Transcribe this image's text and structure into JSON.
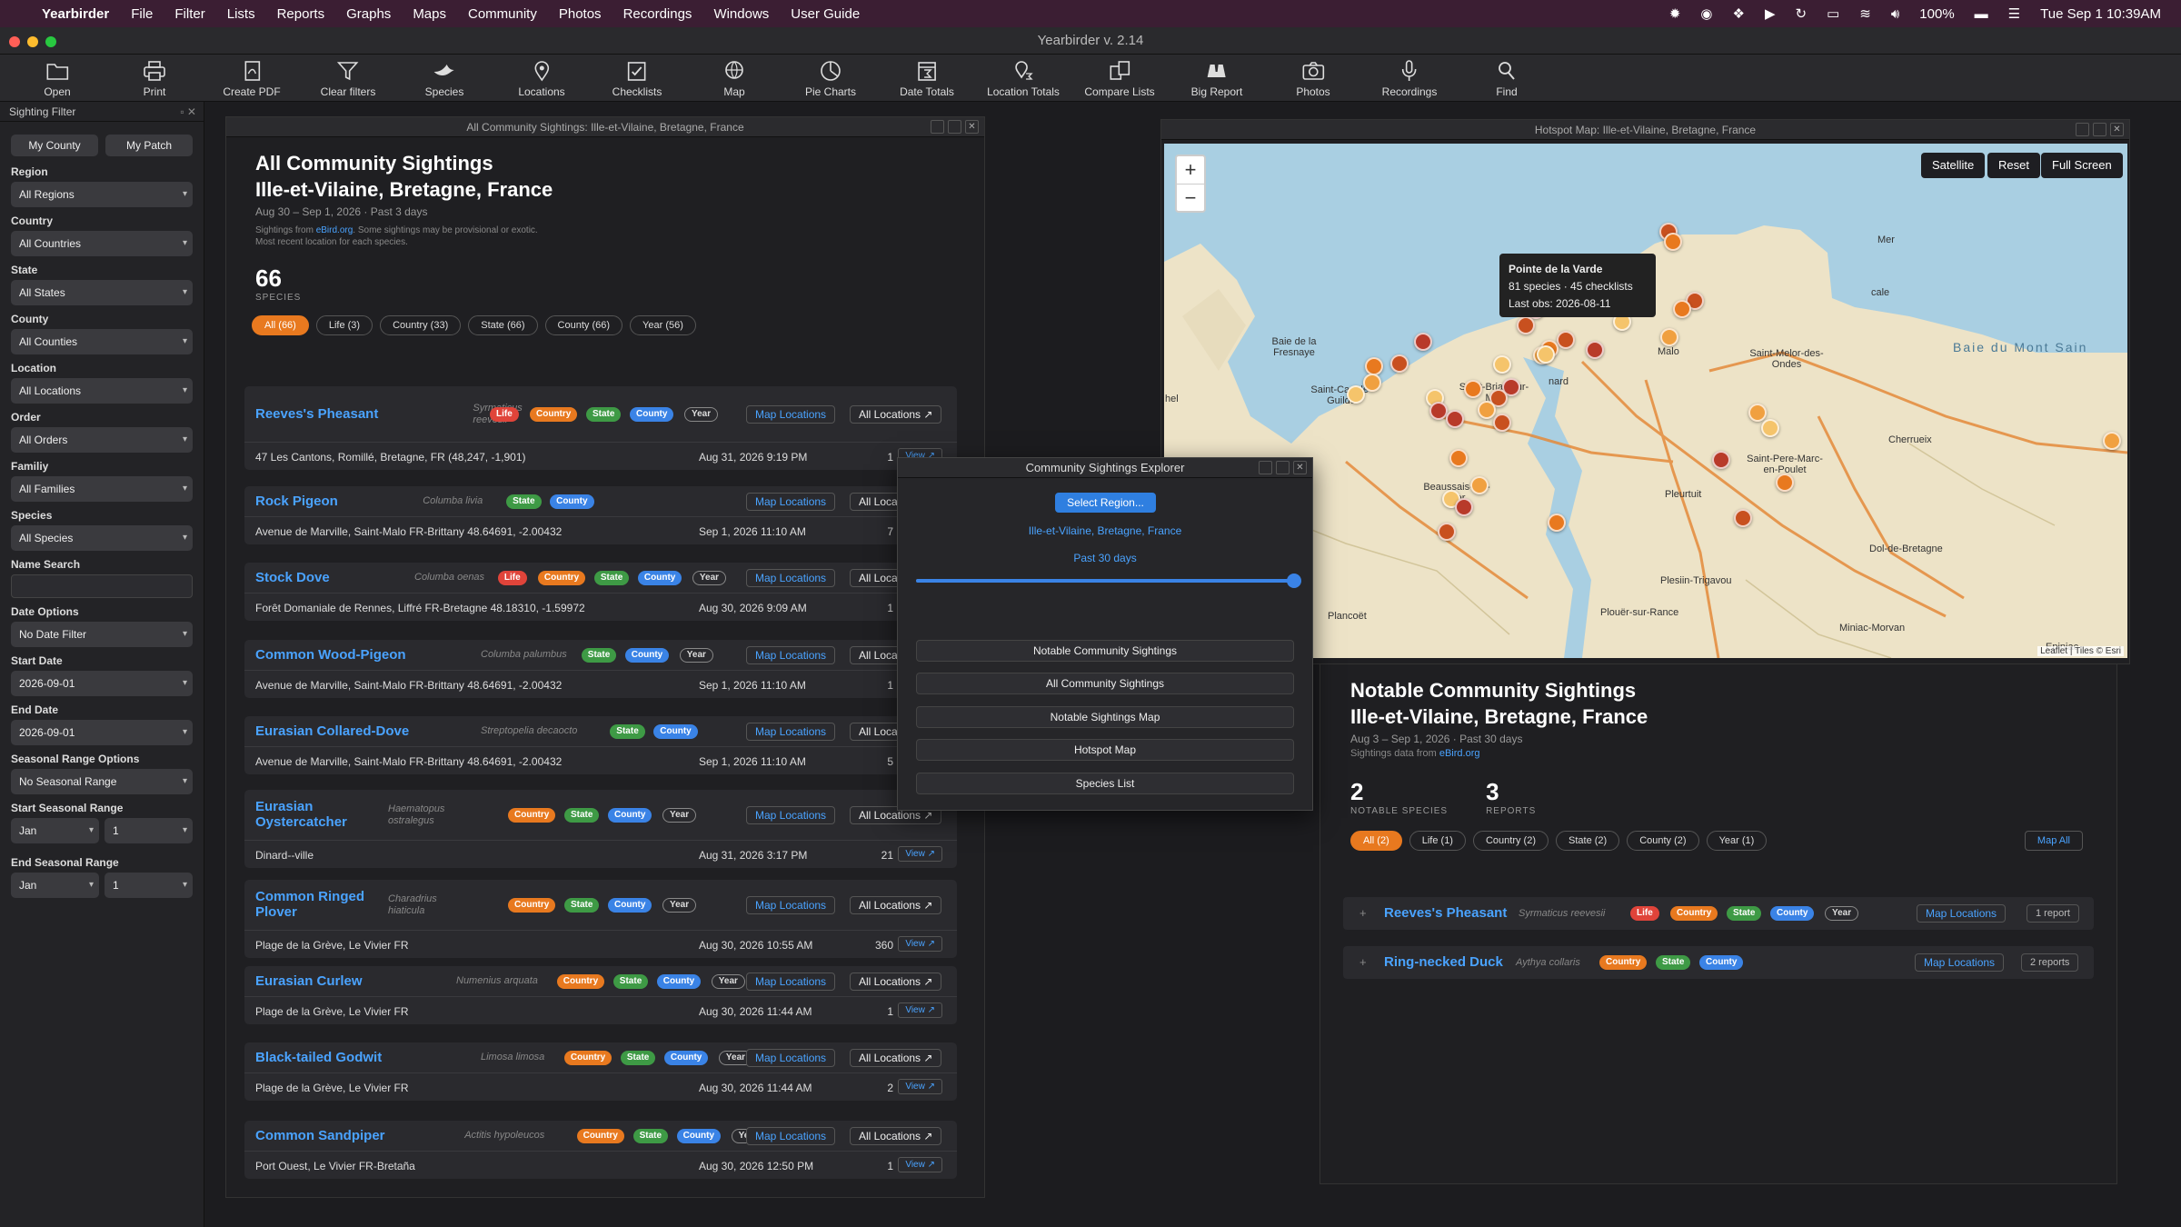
{
  "menubar": {
    "app": "Yearbirder",
    "items": [
      "File",
      "Filter",
      "Lists",
      "Reports",
      "Graphs",
      "Maps",
      "Community",
      "Photos",
      "Recordings",
      "Windows",
      "User Guide"
    ],
    "battery": "100%",
    "datetime": "Tue Sep 1  10:39AM"
  },
  "window": {
    "title": "Yearbirder v. 2.14"
  },
  "toolbar": [
    "Open",
    "Print",
    "Create PDF",
    "Clear filters",
    "Species",
    "Locations",
    "Checklists",
    "Map",
    "Pie Charts",
    "Date Totals",
    "Location Totals",
    "Compare Lists",
    "Big Report",
    "Photos",
    "Recordings",
    "Find"
  ],
  "sidebar": {
    "title": "Sighting Filter",
    "my_county": "My County",
    "my_patch": "My Patch",
    "fields": [
      {
        "label": "Region",
        "value": "All Regions"
      },
      {
        "label": "Country",
        "value": "All Countries"
      },
      {
        "label": "State",
        "value": "All States"
      },
      {
        "label": "County",
        "value": "All Counties"
      },
      {
        "label": "Location",
        "value": "All Locations"
      },
      {
        "label": "Order",
        "value": "All Orders"
      },
      {
        "label": "Familiy",
        "value": "All Families"
      },
      {
        "label": "Species",
        "value": "All Species"
      }
    ],
    "name_search": "Name Search",
    "date_options": "Date Options",
    "date_filter": "No Date Filter",
    "start_date_label": "Start Date",
    "start_date": "2026-09-01",
    "end_date_label": "End Date",
    "end_date": "2026-09-01",
    "seasonal_label": "Seasonal Range Options",
    "seasonal": "No Seasonal Range",
    "start_seasonal_label": "Start Seasonal Range",
    "end_seasonal_label": "End Seasonal Range",
    "month": "Jan",
    "day": "1"
  },
  "all_panel": {
    "window_title": "All Community Sightings: Ille-et-Vilaine, Bretagne, France",
    "title1": "All Community Sightings",
    "title2": "Ille-et-Vilaine, Bretagne, France",
    "range": "Aug 30 – Sep 1, 2026  ·  Past 3 days",
    "note_pre": "Sightings from ",
    "note_link": "eBird.org",
    "note_post": ". Some sightings may be provisional or exotic.",
    "note2": "Most recent location for each species.",
    "count": "66",
    "count_label": "SPECIES",
    "filters": [
      "All (66)",
      "Life (3)",
      "Country (33)",
      "State (66)",
      "County (66)",
      "Year (56)"
    ],
    "map_locations": "Map Locations",
    "all_locations": "All Locations ↗",
    "all_loca": "All Loca",
    "view": "View ↗",
    "rows": [
      {
        "name": "Reeves's Pheasant",
        "name2": "",
        "sci": "Syrmaticus",
        "sci2": "reevesii",
        "badges": [
          "Life",
          "Country",
          "State",
          "County",
          "Year"
        ],
        "loc": "47 Les Cantons, Romillé, Bretagne, FR (48,247, -1,901)",
        "date": "Aug 31, 2026 9:19 PM",
        "count": "1"
      },
      {
        "name": "Rock Pigeon",
        "sci": "Columba livia",
        "badges": [
          "State",
          "County"
        ],
        "loc": "Avenue de Marville, Saint-Malo FR-Brittany 48.64691, -2.00432",
        "date": "Sep 1, 2026 11:10 AM",
        "count": "7"
      },
      {
        "name": "Stock Dove",
        "sci": "Columba oenas",
        "badges": [
          "Life",
          "Country",
          "State",
          "County",
          "Year"
        ],
        "loc": "Forêt Domaniale de Rennes, Liffré FR-Bretagne 48.18310, -1.59972",
        "date": "Aug 30, 2026 9:09 AM",
        "count": "1"
      },
      {
        "name": "Common Wood-Pigeon",
        "sci": "Columba palumbus",
        "badges": [
          "State",
          "County",
          "Year"
        ],
        "loc": "Avenue de Marville, Saint-Malo FR-Brittany 48.64691, -2.00432",
        "date": "Sep 1, 2026 11:10 AM",
        "count": "1"
      },
      {
        "name": "Eurasian Collared-Dove",
        "sci": "Streptopelia decaocto",
        "badges": [
          "State",
          "County"
        ],
        "loc": "Avenue de Marville, Saint-Malo FR-Brittany 48.64691, -2.00432",
        "date": "Sep 1, 2026 11:10 AM",
        "count": "5"
      },
      {
        "name": "Eurasian",
        "name2": "Oystercatcher",
        "sci": "Haematopus",
        "sci2": "ostralegus",
        "badges": [
          "Country",
          "State",
          "County",
          "Year"
        ],
        "loc": "Dinard--ville",
        "date": "Aug 31, 2026 3:17 PM",
        "count": "21"
      },
      {
        "name": "Common Ringed",
        "name2": "Plover",
        "sci": "Charadrius",
        "sci2": "hiaticula",
        "badges": [
          "Country",
          "State",
          "County",
          "Year"
        ],
        "loc": "Plage de la Grève, Le Vivier FR",
        "date": "Aug 30, 2026 10:55 AM",
        "count": "360"
      },
      {
        "name": "Eurasian Curlew",
        "sci": "Numenius arquata",
        "badges": [
          "Country",
          "State",
          "County",
          "Year"
        ],
        "loc": "Plage de la Grève, Le Vivier FR",
        "date": "Aug 30, 2026 11:44 AM",
        "count": "1"
      },
      {
        "name": "Black-tailed Godwit",
        "sci": "Limosa limosa",
        "badges": [
          "Country",
          "State",
          "County",
          "Year"
        ],
        "loc": "Plage de la Grève, Le Vivier FR",
        "date": "Aug 30, 2026 11:44 AM",
        "count": "2"
      },
      {
        "name": "Common Sandpiper",
        "sci": "Actitis hypoleucos",
        "badges": [
          "Country",
          "State",
          "County",
          "Year"
        ],
        "loc": "Port Ouest, Le Vivier FR-Bretaña",
        "date": "Aug 30, 2026 12:50 PM",
        "count": "1"
      }
    ]
  },
  "explorer": {
    "title": "Community Sightings Explorer",
    "select_region": "Select Region...",
    "region": "Ille-et-Vilaine, Bretagne, France",
    "range": "Past 30 days",
    "slider": 1.0,
    "buttons": [
      "Notable Community Sightings",
      "All Community Sightings",
      "Notable Sightings Map",
      "Hotspot Map",
      "Species List"
    ]
  },
  "map_panel": {
    "window_title": "Hotspot Map: Ille-et-Vilaine, Bretagne, France",
    "satellite": "Satellite",
    "reset": "Reset",
    "full_screen": "Full Screen",
    "zoom_in": "+",
    "zoom_out": "−",
    "tooltip_title": "Pointe de la Varde",
    "tooltip_line1": "81 species  ·  45 checklists",
    "tooltip_line2": "Last obs: 2026-08-11",
    "attribution": "Leaflet | Tiles © Esri",
    "places": [
      "Baie de la Fresnaye",
      "Saint-Cast-le-Guildo",
      "Saint-Briac-sur-Mer",
      "Beaussais-sur-Mer",
      "Pleurtuit",
      "Plesiin-Trigavou",
      "Plouër-sur-Rance",
      "Miniac-Morvan",
      "Saint-Pere-Marc-en-Poulet",
      "Dol-de-Bretagne",
      "Cherrueix",
      "Baie du Mont Sain",
      "Plancoët",
      "Saint-Melor-des-Ondes",
      "Mer",
      "cale",
      "Epiniac",
      "Malo",
      "nard",
      "hel"
    ]
  },
  "notable_panel": {
    "title1": "Notable Community Sightings",
    "title2": "Ille-et-Vilaine, Bretagne, France",
    "range": "Aug 3 – Sep 1, 2026  ·  Past 30 days",
    "note_pre": "Sightings data from ",
    "note_link": "eBird.org",
    "species_count": "2",
    "species_label": "NOTABLE SPECIES",
    "reports_count": "3",
    "reports_label": "REPORTS",
    "filters": [
      "All (2)",
      "Life (1)",
      "Country (2)",
      "State (2)",
      "County (2)",
      "Year (1)"
    ],
    "map_all": "Map All",
    "rows": [
      {
        "name": "Reeves's Pheasant",
        "sci": "Syrmaticus reevesii",
        "badges": [
          "Life",
          "Country",
          "State",
          "County",
          "Year"
        ],
        "reports": "1 report"
      },
      {
        "name": "Ring-necked Duck",
        "sci": "Aythya collaris",
        "badges": [
          "Country",
          "State",
          "County"
        ],
        "reports": "2 reports"
      }
    ],
    "map_locations": "Map Locations"
  },
  "colors": {
    "accent": "#e8791f",
    "link": "#4aa3ff",
    "life": "#e0443a",
    "country": "#e8791f",
    "state": "#3e9a45",
    "county": "#3a83e6"
  }
}
